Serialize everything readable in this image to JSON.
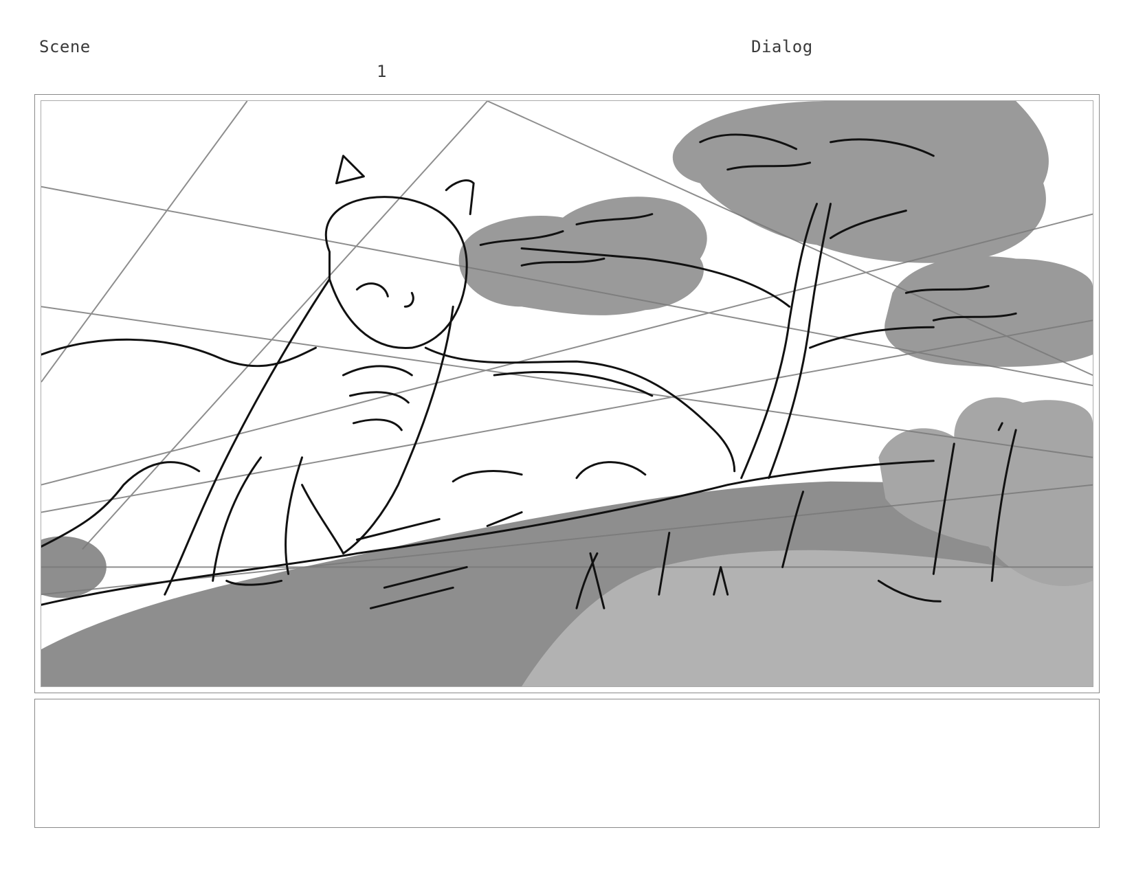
{
  "header": {
    "scene_label": "Scene",
    "scene_number": "1",
    "dialog_label": "Dialog"
  },
  "panel": {
    "illustration": "storyboard-sketch"
  },
  "dialog": {
    "text": ""
  },
  "colors": {
    "shadow_dark": "#8a8a8a",
    "shadow_mid": "#9c9c9c",
    "shadow_light": "#b4b4b4",
    "ink": "#111111",
    "guide_line": "#7a7a7a"
  }
}
